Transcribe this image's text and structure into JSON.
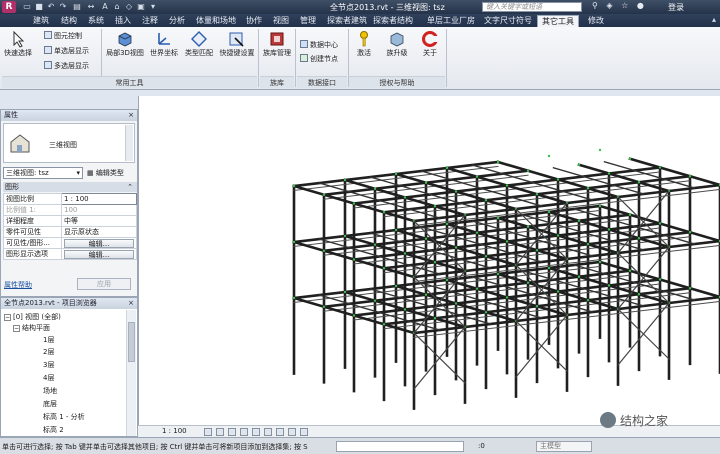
{
  "titlebar": {
    "title": "全节点2013.rvt - 三维视图: tsz",
    "search_placeholder": "键入关键字或短语",
    "login": "登录"
  },
  "tabs": [
    "建筑",
    "结构",
    "系统",
    "插入",
    "注释",
    "分析",
    "体量和场地",
    "协作",
    "视图",
    "管理",
    "探索者建筑",
    "探索者结构",
    "单层工业厂房",
    "文字尺寸符号",
    "其它工具",
    "修改"
  ],
  "active_tab": "其它工具",
  "ribbon": {
    "quick_select": "快速选择",
    "element_control": "图元控制",
    "single_display": "单选层显示",
    "multi_display": "多选层显示",
    "local_3d": "局部3D视图",
    "world_coord": "世界坐标",
    "type_match": "类型匹配",
    "shortcut_keys": "快捷键设置",
    "family_manager": "族库管理",
    "data_center": "数据中心",
    "create_node": "创建节点",
    "activate": "激活",
    "family_upgrade": "族升级",
    "about": "关于",
    "group_common": "常用工具",
    "group_family": "族库",
    "group_data": "数据接口",
    "group_auth": "授权与帮助"
  },
  "properties": {
    "header": "属性",
    "type_name": "三维视图",
    "view_select": "三维视图: tsz",
    "edit_type": "编辑类型",
    "section": "图形",
    "rows": [
      {
        "k": "视图比例",
        "v": "1 : 100"
      },
      {
        "k": "比例值 1:",
        "v": "100"
      },
      {
        "k": "详细程度",
        "v": "中等"
      },
      {
        "k": "零件可见性",
        "v": "显示原状态"
      },
      {
        "k": "可见性/图形...",
        "v": "编辑..."
      },
      {
        "k": "图形显示选项",
        "v": "编辑..."
      }
    ],
    "help_link": "属性帮助",
    "apply": "应用"
  },
  "browser": {
    "header": "全节点2013.rvt - 项目浏览器",
    "views_root": "视图 (全部)",
    "plan_group": "结构平面",
    "items": [
      "1层",
      "2层",
      "3层",
      "4层",
      "场地",
      "底层",
      "标高 1 - 分析",
      "标高 2"
    ]
  },
  "viewbar": {
    "scale": "1 : 100"
  },
  "statusbar": {
    "message": "单击可进行选择; 按 Tab 键并单击可选择其他项目; 按 Ctrl 键并单击可将新项目添加到选择集; 按 S",
    "zero": ":0",
    "model": "主模型"
  },
  "watermark": "结构之家",
  "colors": {
    "titlebar": "#2e3d55",
    "ribbon": "#eef1f5",
    "steel": "#1e1f1e",
    "node_accent": "#3cbf4e"
  }
}
